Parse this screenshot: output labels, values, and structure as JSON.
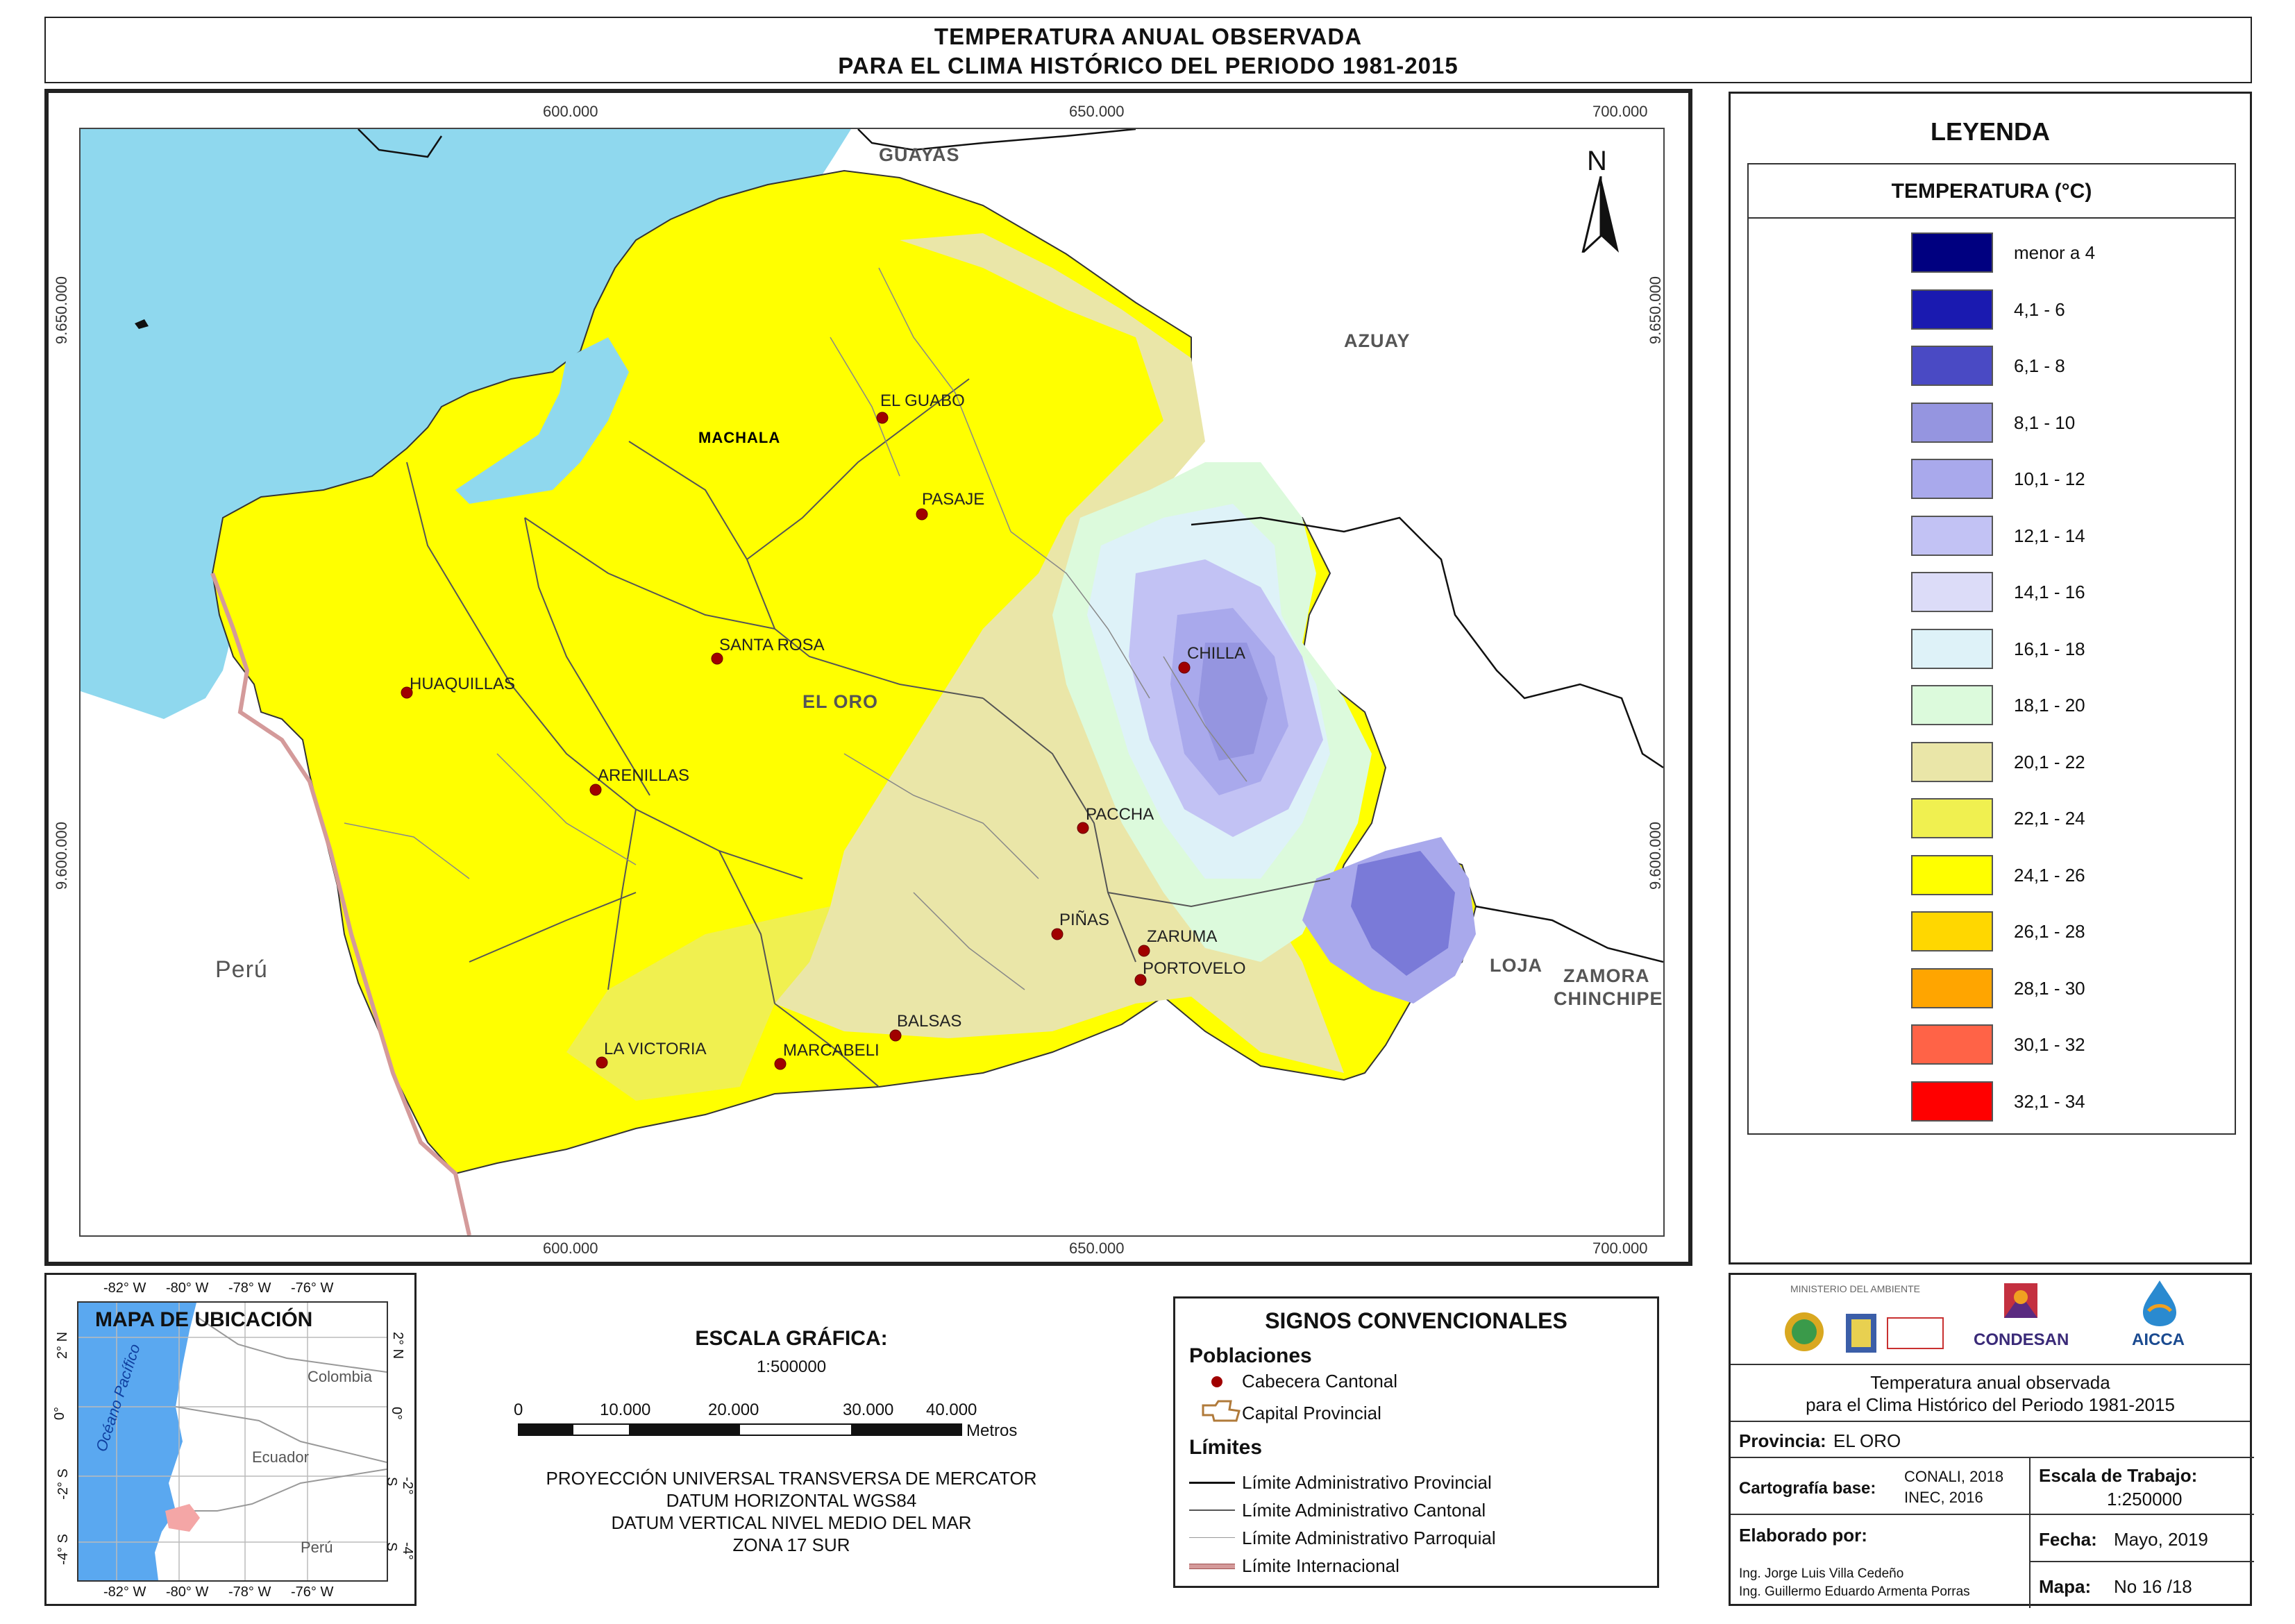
{
  "title": {
    "line1": "TEMPERATURA ANUAL OBSERVADA",
    "line2": "PARA EL CLIMA HISTÓRICO DEL PERIODO 1981-2015"
  },
  "map": {
    "ticks_top": [
      "600.000",
      "650.000",
      "700.000"
    ],
    "ticks_bottom": [
      "600.000",
      "650.000",
      "700.000"
    ],
    "ticks_left": [
      "9.650.000",
      "9.600.000"
    ],
    "ticks_right": [
      "9.650.000",
      "9.600.000"
    ],
    "north": "N",
    "regions": {
      "guayas": "GUAYAS",
      "azuay": "AZUAY",
      "el_oro": "EL ORO",
      "loja": "LOJA",
      "zamora": "ZAMORA",
      "chinchipe": "CHINCHIPE",
      "peru": "Perú",
      "machala": "MACHALA"
    },
    "towns": {
      "el_guabo": "EL GUABO",
      "pasaje": "PASAJE",
      "santa_rosa": "SANTA ROSA",
      "huaquillas": "HUAQUILLAS",
      "arenillas": "ARENILLAS",
      "chilla": "CHILLA",
      "paccha": "PACCHA",
      "pinas": "PIÑAS",
      "zaruma": "ZARUMA",
      "portovelo": "PORTOVELO",
      "balsas": "BALSAS",
      "marcabeli": "MARCABELI",
      "la_victoria": "LA VICTORIA"
    },
    "colors": {
      "sea": "#8fd8ee",
      "lowland": "#ffff00",
      "border_intl": "#d49a9a"
    }
  },
  "legend": {
    "title": "LEYENDA",
    "subtitle": "TEMPERATURA (°C)",
    "classes": [
      {
        "label": "menor a 4",
        "color": "#000080"
      },
      {
        "label": "4,1 - 6",
        "color": "#1a1ab0"
      },
      {
        "label": "6,1 - 8",
        "color": "#4a4ac4"
      },
      {
        "label": "8,1 - 10",
        "color": "#9595e0"
      },
      {
        "label": "10,1 - 12",
        "color": "#a9a9ec"
      },
      {
        "label": "12,1 - 14",
        "color": "#c2c2f4"
      },
      {
        "label": "14,1 - 16",
        "color": "#dcdcf8"
      },
      {
        "label": "16,1 - 18",
        "color": "#def2f8"
      },
      {
        "label": "18,1 - 20",
        "color": "#dcfadc"
      },
      {
        "label": "20,1 - 22",
        "color": "#eae6a8"
      },
      {
        "label": "22,1 - 24",
        "color": "#f0f050"
      },
      {
        "label": "24,1 - 26",
        "color": "#ffff00"
      },
      {
        "label": "26,1 - 28",
        "color": "#ffd700"
      },
      {
        "label": "28,1 - 30",
        "color": "#ffa500"
      },
      {
        "label": "30,1 - 32",
        "color": "#ff6347"
      },
      {
        "label": "32,1 - 34",
        "color": "#ff0000"
      }
    ]
  },
  "location": {
    "title": "MAPA DE UBICACIÓN",
    "lon_labels": [
      "-82° W",
      "-80° W",
      "-78° W",
      "-76° W"
    ],
    "lat_left": [
      "2° N",
      "0°",
      "-2° S",
      "-4° S"
    ],
    "lat_right": [
      "2° N",
      "0°",
      "-2° S",
      "-4° S"
    ],
    "countries": {
      "colombia": "Colombia",
      "ecuador": "Ecuador",
      "peru": "Perú"
    },
    "ocean": "Océano Pacífico"
  },
  "scale": {
    "title": "ESCALA GRÁFICA:",
    "ratio": "1:500000",
    "ticks": [
      "0",
      "10.000",
      "20.000",
      "30.000",
      "40.000"
    ],
    "unit": "Metros",
    "projection": [
      "PROYECCIÓN UNIVERSAL TRANSVERSA DE MERCATOR",
      "DATUM HORIZONTAL WGS84",
      "DATUM VERTICAL NIVEL MEDIO DEL MAR",
      "ZONA 17 SUR"
    ]
  },
  "signs": {
    "title": "SIGNOS CONVENCIONALES",
    "poblaciones": "Poblaciones",
    "cabecera": "Cabecera Cantonal",
    "capital": "Capital Provincial",
    "limites": "Límites",
    "lim_prov": "Límite Administrativo Provincial",
    "lim_cant": "Límite Administrativo Cantonal",
    "lim_parr": "Límite Administrativo Parroquial",
    "lim_intl": "Límite Internacional"
  },
  "info": {
    "ministerio": "MINISTERIO DEL AMBIENTE",
    "condesan": "CONDESAN",
    "aicca": "AICCA",
    "desc1": "Temperatura anual observada",
    "desc2": "para el Clima Histórico del Periodo 1981-2015",
    "provincia_label": "Provincia:",
    "provincia": "EL ORO",
    "carto_label": "Cartografía base:",
    "carto1": "CONALI, 2018",
    "carto2": "INEC, 2016",
    "escala_label": "Escala de Trabajo:",
    "escala": "1:250000",
    "elab_label": "Elaborado por:",
    "elab1": "Ing. Jorge Luis Villa Cedeño",
    "elab2": "Ing. Guillermo Eduardo Armenta Porras",
    "fecha_label": "Fecha:",
    "fecha": "Mayo, 2019",
    "mapa_label": "Mapa:",
    "mapa": "No 16 /18"
  }
}
